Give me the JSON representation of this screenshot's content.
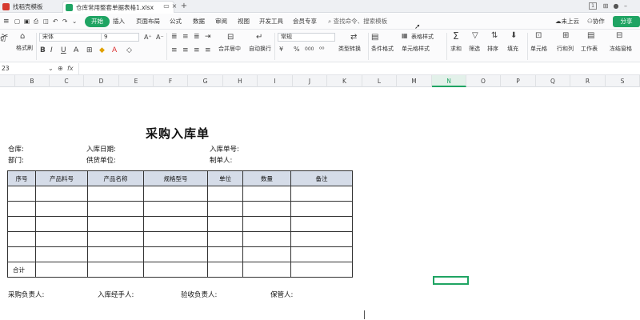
{
  "titlebar": {
    "tabs": [
      {
        "label": "找稻壳模板",
        "icon_color": "#d63a2f"
      },
      {
        "label": "仓库常用整套单据表格1.xlsx",
        "icon_color": "#1fa463"
      }
    ],
    "add_tab": "+",
    "window_count": "1"
  },
  "menubar": {
    "items": [
      "开始",
      "插入",
      "页面布局",
      "公式",
      "数据",
      "审阅",
      "视图",
      "开发工具",
      "会员专享"
    ],
    "search_placeholder": "查找命令、搜索模板",
    "cloud_label": "未上云",
    "collab_label": "协作",
    "share_label": "分享"
  },
  "ribbon": {
    "clip_label": "切",
    "format_painter_label": "格式刷",
    "font_name": "宋体",
    "font_size": "9",
    "bold": "B",
    "italic": "I",
    "underline": "U",
    "merge_label": "合并居中",
    "wrap_label": "自动换行",
    "number_format": "常规",
    "percent": "%",
    "thousands": "000",
    "type_convert_label": "类型转换",
    "table_style_label": "表格样式",
    "cond_format_label": "条件格式",
    "cell_style_label": "单元格样式",
    "sum_label": "求和",
    "filter_label": "筛选",
    "sort_label": "排序",
    "fill_label": "填充",
    "cell_label": "单元格",
    "row_col_label": "行和列",
    "worksheet_label": "工作表",
    "freeze_label": "冻结窗格"
  },
  "formulabar": {
    "name_box": "23",
    "fx": "fx"
  },
  "columns": [
    {
      "label": "B",
      "w": 43
    },
    {
      "label": "C",
      "w": 43
    },
    {
      "label": "D",
      "w": 44
    },
    {
      "label": "E",
      "w": 43
    },
    {
      "label": "F",
      "w": 43
    },
    {
      "label": "G",
      "w": 44
    },
    {
      "label": "H",
      "w": 43
    },
    {
      "label": "I",
      "w": 44
    },
    {
      "label": "J",
      "w": 43
    },
    {
      "label": "K",
      "w": 44
    },
    {
      "label": "L",
      "w": 43
    },
    {
      "label": "M",
      "w": 44
    },
    {
      "label": "N",
      "w": 43
    },
    {
      "label": "O",
      "w": 43
    },
    {
      "label": "P",
      "w": 44
    },
    {
      "label": "Q",
      "w": 43
    },
    {
      "label": "R",
      "w": 44
    },
    {
      "label": "S",
      "w": 43
    }
  ],
  "selected_column": "N",
  "sheet": {
    "title": "采购入库单",
    "warehouse_label": "仓库:",
    "entry_date_label": "入库日期:",
    "entry_no_label": "入库单号:",
    "dept_label": "部门:",
    "supplier_label": "供货单位:",
    "creator_label": "制单人:",
    "table_headers": [
      "序号",
      "产品料号",
      "产品名称",
      "规格型号",
      "单位",
      "数量",
      "备注"
    ],
    "empty_rows": 5,
    "total_label": "合计",
    "footer": {
      "buyer_label": "采购负责人:",
      "handler_label": "入库经手人:",
      "inspector_label": "验收负责人:",
      "keeper_label": "保管人:"
    }
  },
  "colors": {
    "accent": "#1fa463",
    "header_fill": "#d5dce8"
  }
}
